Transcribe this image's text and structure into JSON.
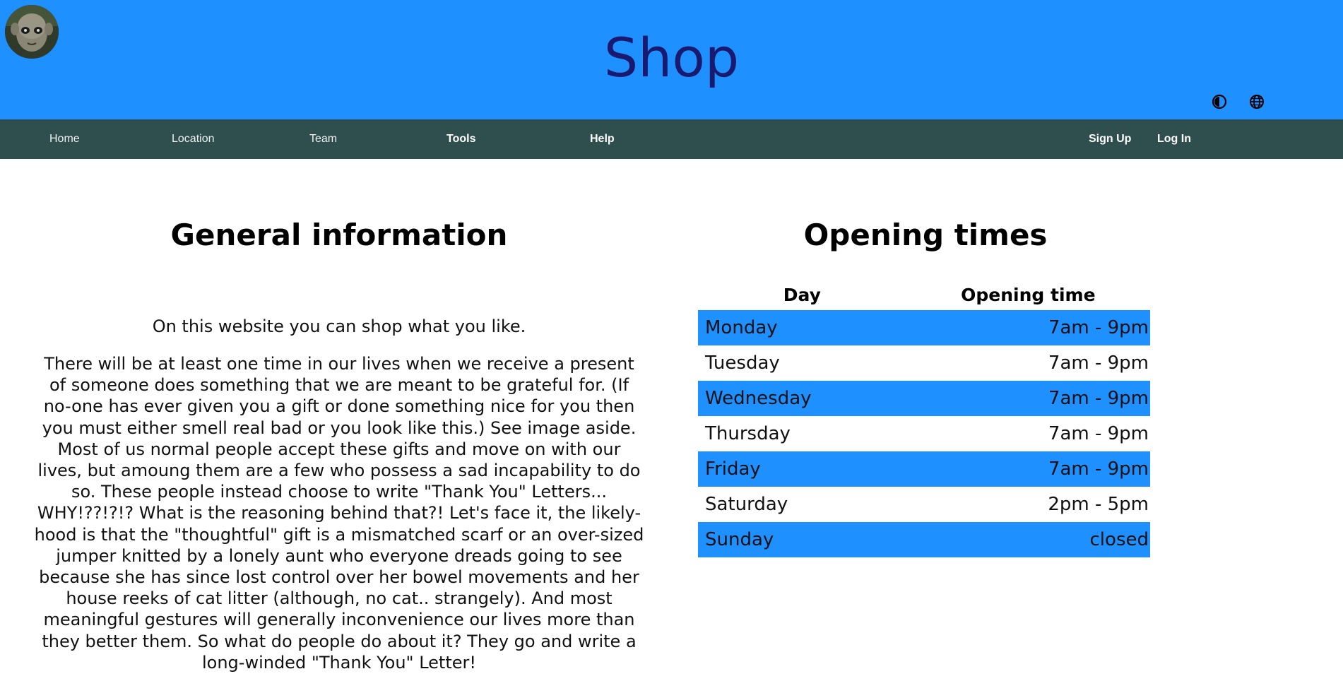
{
  "header": {
    "title": "Shop",
    "avatar_icon": "avatar-image",
    "theme_icon": "contrast-icon",
    "language_icon": "globe-icon",
    "colors": {
      "header_bg": "#1e90ff",
      "title": "#191970"
    }
  },
  "nav": {
    "items": [
      "Home",
      "Location",
      "Team",
      "Tools",
      "Help"
    ],
    "sign_up": "Sign Up",
    "log_in": "Log In",
    "colors": {
      "bg": "#2f4f4f"
    }
  },
  "general": {
    "title": "General information",
    "intro": "On this website you can shop what you like.",
    "body": "There will be at least one time in our lives when we receive a present of someone does something that we are meant to be grateful for. (If no-one has ever given you a gift or done something nice for you then you must either smell real bad or you look like this.) See image aside. Most of us normal people accept these gifts and move on with our lives, but amoung them are a few who possess a sad incapability to do so. These people instead choose to write \"Thank You\" Letters... WHY!??!?!? What is the reasoning behind that?! Let's face it, the likely-hood is that the \"thoughtful\" gift is a mismatched scarf or an over-sized jumper knitted by a lonely aunt who everyone dreads going to see because she has since lost control over her bowel movements and her house reeks of cat litter (although, no cat.. strangely). And most meaningful gestures will generally inconvenience our lives more than they better them. So what do people do about it? They go and write a long-winded \"Thank You\" Letter!"
  },
  "opening": {
    "title": "Opening times",
    "headers": {
      "day": "Day",
      "time": "Opening time"
    },
    "rows": [
      {
        "day": "Monday",
        "time": "7am - 9pm"
      },
      {
        "day": "Tuesday",
        "time": "7am - 9pm"
      },
      {
        "day": "Wednesday",
        "time": "7am - 9pm"
      },
      {
        "day": "Thursday",
        "time": "7am - 9pm"
      },
      {
        "day": "Friday",
        "time": "7am - 9pm"
      },
      {
        "day": "Saturday",
        "time": "2pm - 5pm"
      },
      {
        "day": "Sunday",
        "time": "closed"
      }
    ],
    "colors": {
      "stripe": "#1e90ff"
    }
  }
}
